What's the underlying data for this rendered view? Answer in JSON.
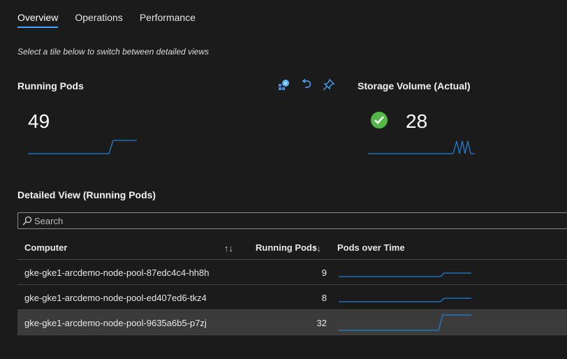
{
  "tabs": [
    {
      "label": "Overview",
      "active": true
    },
    {
      "label": "Operations",
      "active": false
    },
    {
      "label": "Performance",
      "active": false
    }
  ],
  "hint": "Select a tile below to switch between detailed views",
  "tiles": {
    "running_pods": {
      "title": "Running Pods",
      "value": "49"
    },
    "storage": {
      "title": "Storage Volume (Actual)",
      "value": "28",
      "status_icon": "check-circle-icon"
    }
  },
  "tile_actions": [
    "insights-icon",
    "undo-icon",
    "pin-icon"
  ],
  "detail_title": "Detailed View (Running Pods)",
  "search": {
    "placeholder": "Search",
    "value": ""
  },
  "table": {
    "headers": {
      "computer": "Computer",
      "running_pods": "Running Pods",
      "pods_over_time": "Pods over Time"
    },
    "rows": [
      {
        "computer": "gke-gke1-arcdemo-node-pool-87edc4c4-hh8h",
        "running_pods": "9",
        "selected": false
      },
      {
        "computer": "gke-gke1-arcdemo-node-pool-ed407ed6-tkz4",
        "running_pods": "8",
        "selected": false
      },
      {
        "computer": "gke-gke1-arcdemo-node-pool-9635a6b5-p7zj",
        "running_pods": "32",
        "selected": true
      }
    ]
  },
  "colors": {
    "accent": "#4aa3ff",
    "sparkline": "#1f7fd6",
    "success": "#54b848",
    "background": "#1b1b1b",
    "selected_row": "#3b3b3b"
  }
}
